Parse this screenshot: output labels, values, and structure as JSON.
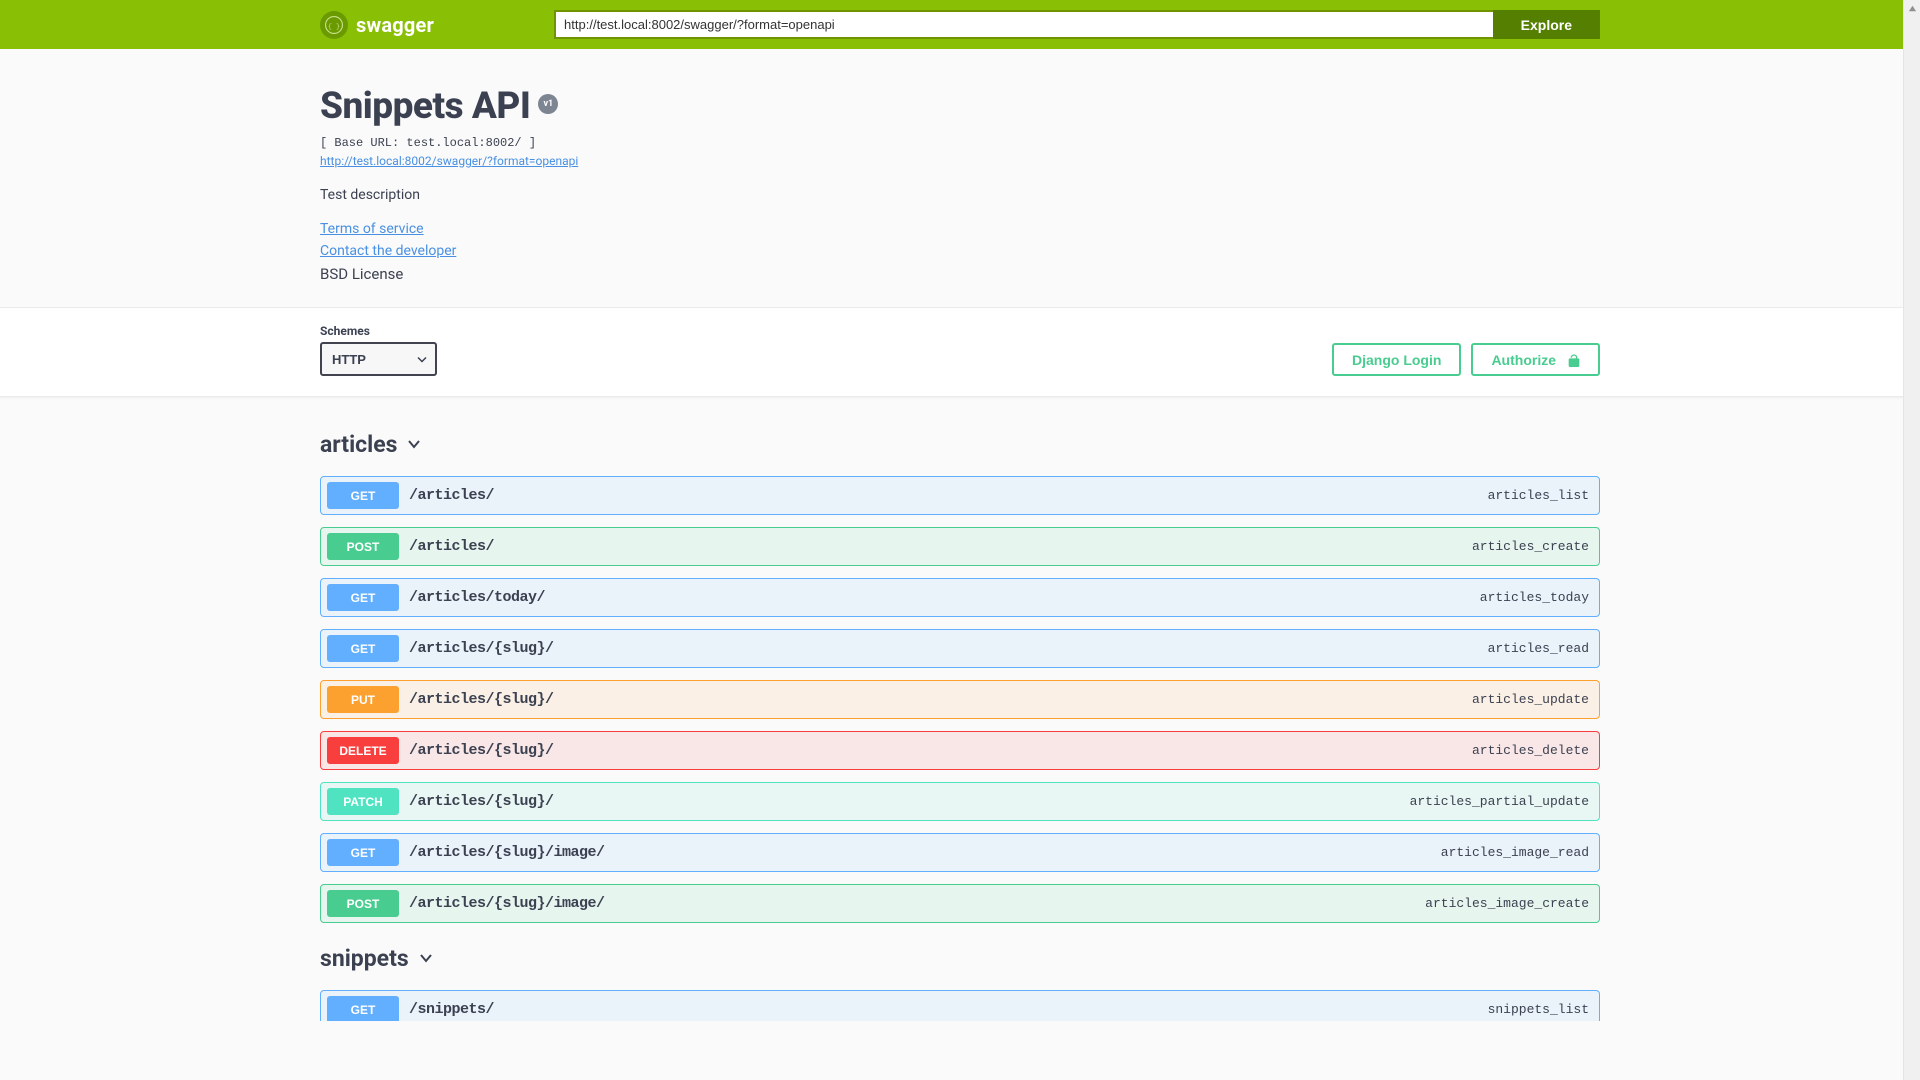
{
  "topbar": {
    "brand": "swagger",
    "url_value": "http://test.local:8002/swagger/?format=openapi",
    "explore_label": "Explore"
  },
  "info": {
    "title": "Snippets API",
    "version_badge": "v1",
    "base_url_label": "[ Base URL: test.local:8002/ ]",
    "spec_url": "http://test.local:8002/swagger/?format=openapi",
    "description": "Test description",
    "tos_label": "Terms of service",
    "contact_label": "Contact the developer",
    "license": "BSD License"
  },
  "schemes": {
    "label": "Schemes",
    "selected": "HTTP"
  },
  "auth": {
    "login_label": "Django Login",
    "authorize_label": "Authorize"
  },
  "tags": {
    "articles": {
      "name": "articles",
      "ops": [
        {
          "method": "GET",
          "path": "/articles/",
          "id": "articles_list"
        },
        {
          "method": "POST",
          "path": "/articles/",
          "id": "articles_create"
        },
        {
          "method": "GET",
          "path": "/articles/today/",
          "id": "articles_today"
        },
        {
          "method": "GET",
          "path": "/articles/{slug}/",
          "id": "articles_read"
        },
        {
          "method": "PUT",
          "path": "/articles/{slug}/",
          "id": "articles_update"
        },
        {
          "method": "DELETE",
          "path": "/articles/{slug}/",
          "id": "articles_delete"
        },
        {
          "method": "PATCH",
          "path": "/articles/{slug}/",
          "id": "articles_partial_update"
        },
        {
          "method": "GET",
          "path": "/articles/{slug}/image/",
          "id": "articles_image_read"
        },
        {
          "method": "POST",
          "path": "/articles/{slug}/image/",
          "id": "articles_image_create"
        }
      ]
    },
    "snippets": {
      "name": "snippets",
      "ops": [
        {
          "method": "GET",
          "path": "/snippets/",
          "id": "snippets_list"
        }
      ]
    }
  }
}
